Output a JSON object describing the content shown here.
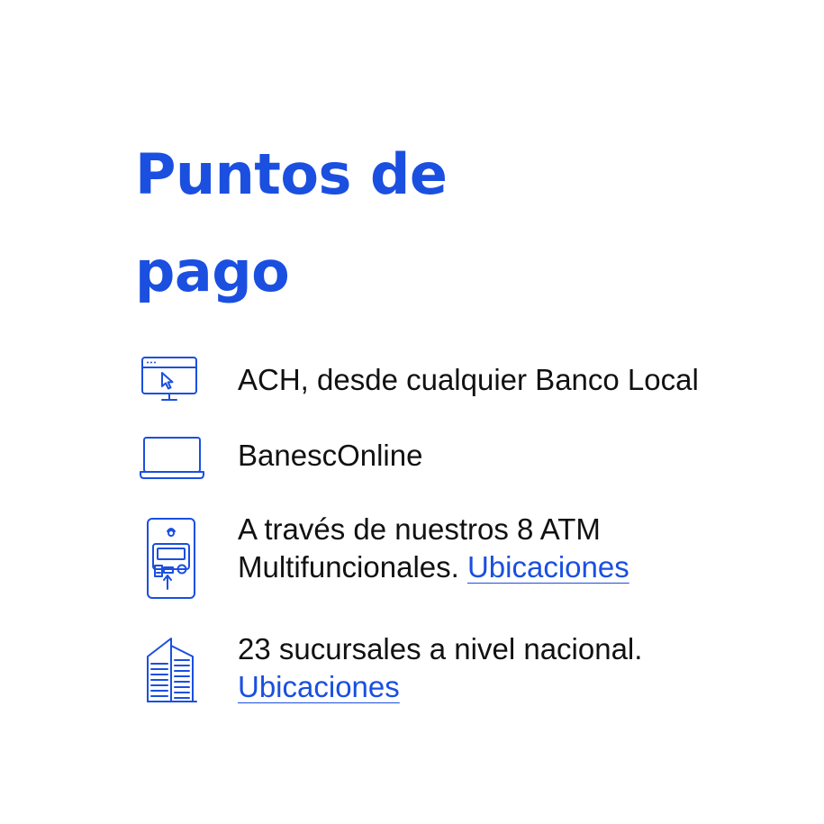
{
  "title_line1": "Puntos de",
  "title_line2": "pago",
  "colors": {
    "accent": "#1a4fe0",
    "text": "#111111",
    "background": "#ffffff"
  },
  "items": [
    {
      "icon": "web-monitor-cursor-icon",
      "text": "ACH, desde cualquier Banco Local"
    },
    {
      "icon": "laptop-icon",
      "text": "BanescOnline"
    },
    {
      "icon": "atm-icon",
      "text_line1": "A través de nuestros 8 ATM",
      "text_line2": "Multifuncionales.",
      "link": "Ubicaciones"
    },
    {
      "icon": "bank-building-icon",
      "text_line1": "23 sucursales a nivel nacional.",
      "link": "Ubicaciones"
    }
  ]
}
